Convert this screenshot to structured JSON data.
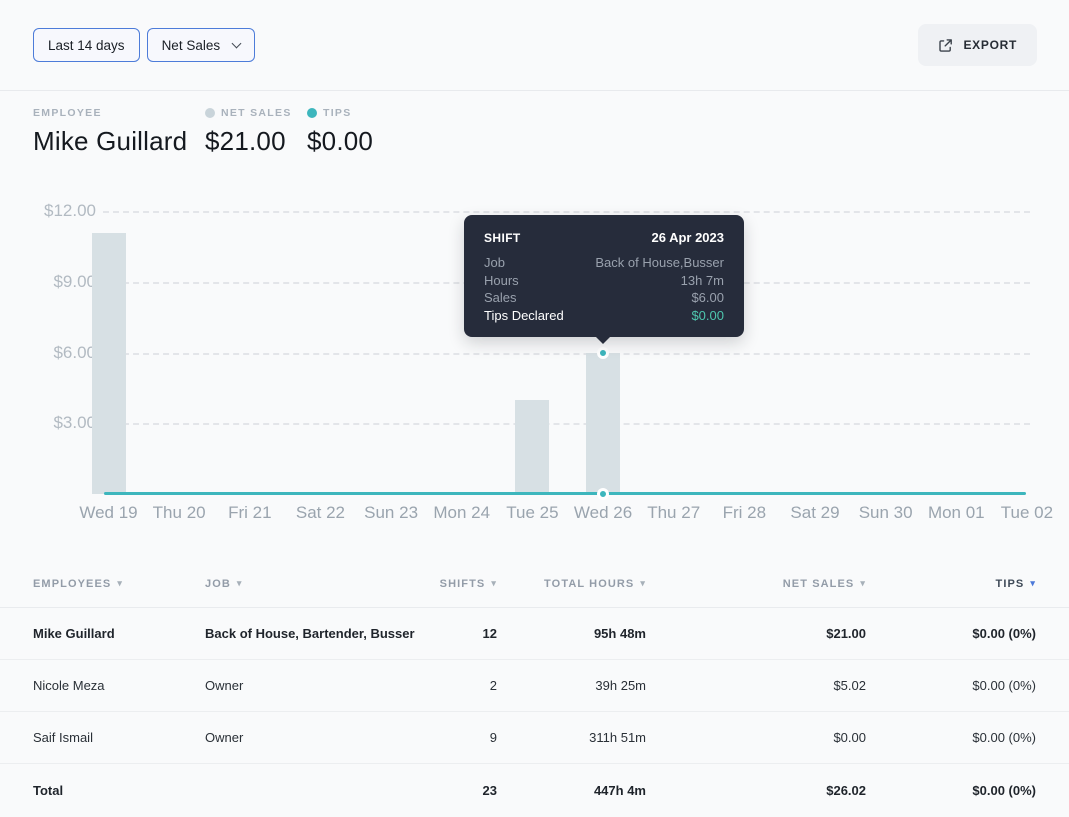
{
  "toolbar": {
    "date_range_label": "Last 14 days",
    "metric_select_label": "Net Sales",
    "export_label": "EXPORT"
  },
  "summary": {
    "employee_label": "EMPLOYEE",
    "employee_name": "Mike Guillard",
    "net_sales_label": "NET SALES",
    "net_sales_value": "$21.00",
    "tips_label": "TIPS",
    "tips_value": "$0.00"
  },
  "colors": {
    "accent_teal": "#3db6bd",
    "tips_value_teal": "#4ec7ae",
    "bar_fill": "#d7e0e4",
    "net_sales_dot": "#c9d4da",
    "button_border_blue": "#4d7cd9",
    "sort_active_blue": "#4c79d9",
    "tooltip_bg": "#262c3b"
  },
  "chart_data": {
    "type": "bar",
    "title": "",
    "xlabel": "",
    "ylabel": "",
    "categories": [
      "Wed 19",
      "Thu 20",
      "Fri 21",
      "Sat 22",
      "Sun 23",
      "Mon 24",
      "Tue 25",
      "Wed 26",
      "Thu 27",
      "Fri 28",
      "Sat 29",
      "Sun 30",
      "Mon 01",
      "Tue 02"
    ],
    "series": [
      {
        "name": "Net Sales",
        "render": "bar",
        "color": "#d7e0e4",
        "values": [
          11.05,
          0,
          0,
          0,
          0,
          0,
          4.0,
          6.0,
          0,
          0,
          0,
          0,
          0,
          0
        ]
      },
      {
        "name": "Tips",
        "render": "line",
        "color": "#3db6bd",
        "values": [
          0,
          0,
          0,
          0,
          0,
          0,
          0,
          0,
          0,
          0,
          0,
          0,
          0,
          0
        ]
      }
    ],
    "y_axis": {
      "min": 0,
      "max": 12.7,
      "ticks": [
        {
          "value": 12,
          "label": "$12.00"
        },
        {
          "value": 9,
          "label": "$9.00"
        },
        {
          "value": 6,
          "label": "$6.00"
        },
        {
          "value": 3,
          "label": "$3.00"
        }
      ]
    },
    "grid": "horizontal-dashed",
    "legend_position": "none",
    "highlight": {
      "category_index": 7,
      "sales_value": 6.0,
      "tips_value": 0
    }
  },
  "tooltip": {
    "title": "SHIFT",
    "date": "26 Apr 2023",
    "rows": [
      {
        "label": "Job",
        "value": "Back of House,Busser",
        "highlight": false
      },
      {
        "label": "Hours",
        "value": "13h 7m",
        "highlight": false
      },
      {
        "label": "Sales",
        "value": "$6.00",
        "highlight": false
      },
      {
        "label": "Tips Declared",
        "value": "$0.00",
        "highlight": true
      }
    ]
  },
  "table": {
    "columns": [
      {
        "label": "EMPLOYEES",
        "align": "left",
        "active": false
      },
      {
        "label": "JOB",
        "align": "left",
        "active": false
      },
      {
        "label": "SHIFTS",
        "align": "right",
        "active": false
      },
      {
        "label": "TOTAL HOURS",
        "align": "right",
        "active": false
      },
      {
        "label": "NET SALES",
        "align": "right",
        "active": false
      },
      {
        "label": "TIPS",
        "align": "right",
        "active": true
      }
    ],
    "rows": [
      {
        "employee": "Mike Guillard",
        "job": "Back of House, Bartender, Busser",
        "shifts": "12",
        "hours": "95h 48m",
        "net_sales": "$21.00",
        "tips": "$0.00 (0%)",
        "bold": true
      },
      {
        "employee": "Nicole Meza",
        "job": "Owner",
        "shifts": "2",
        "hours": "39h 25m",
        "net_sales": "$5.02",
        "tips": "$0.00 (0%)",
        "bold": false
      },
      {
        "employee": "Saif Ismail",
        "job": "Owner",
        "shifts": "9",
        "hours": "311h 51m",
        "net_sales": "$0.00",
        "tips": "$0.00 (0%)",
        "bold": false
      }
    ],
    "total": {
      "employee": "Total",
      "job": "",
      "shifts": "23",
      "hours": "447h 4m",
      "net_sales": "$26.02",
      "tips": "$0.00 (0%)",
      "bold": true
    }
  }
}
